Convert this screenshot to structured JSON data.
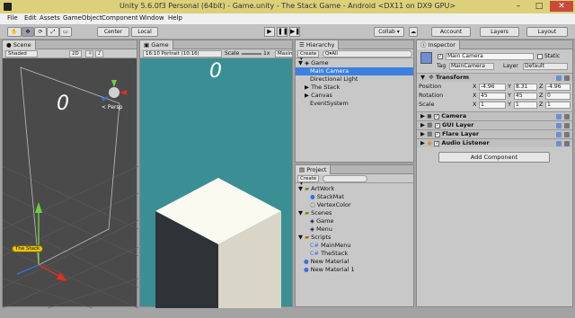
{
  "window": {
    "title": "Unity 5.6.0f3 Personal (64bit) - Game.unity - The Stack Game - Android <DX11 on DX9 GPU>",
    "minimize": "–",
    "maximize": "□",
    "close": "✕"
  },
  "menu": [
    "File",
    "Edit",
    "Assets",
    "GameObject",
    "Component",
    "Window",
    "Help"
  ],
  "toolbar": {
    "center_label": "Center",
    "local_label": "Local",
    "collab_label": "Collab ▾",
    "account_label": "Account",
    "layers_label": "Layers",
    "layout_label": "Layout"
  },
  "scene": {
    "tab_label": "Scene",
    "shading": "Shaded",
    "mode_2d": "2D",
    "score": "0",
    "persp_label": "< Persp",
    "camera_name": "The Stack"
  },
  "game": {
    "tab_label": "Game",
    "aspect": "16:10 Portrait (10:16)",
    "scale_label": "Scale",
    "scale_value": "1x",
    "maximize_label": "Maxim",
    "score": "0"
  },
  "hierarchy": {
    "tab_label": "Hierarchy",
    "create_label": "Create ▾",
    "search_placeholder": "Q▾All",
    "items": [
      {
        "label": "Game",
        "level": 0
      },
      {
        "label": "Main Camera",
        "level": 1
      },
      {
        "label": "Directional Light",
        "level": 1
      },
      {
        "label": "The Stack",
        "level": 1
      },
      {
        "label": "Canvas",
        "level": 1
      },
      {
        "label": "EventSystem",
        "level": 1
      }
    ]
  },
  "project": {
    "tab_label": "Project",
    "create_label": "Create ▾",
    "items": [
      {
        "label": "ArtWork",
        "level": 0
      },
      {
        "label": "StackMat",
        "level": 1
      },
      {
        "label": "VertexColor",
        "level": 1
      },
      {
        "label": "Scenes",
        "level": 0
      },
      {
        "label": "Game",
        "level": 1
      },
      {
        "label": "Menu",
        "level": 1
      },
      {
        "label": "Scripts",
        "level": 0
      },
      {
        "label": "MainMenu",
        "level": 1
      },
      {
        "label": "TheStack",
        "level": 1
      },
      {
        "label": "New Material",
        "level": 0
      },
      {
        "label": "New Material 1",
        "level": 0
      }
    ]
  },
  "inspector": {
    "tab_label": "Inspector",
    "object_name": "Main Camera",
    "static_label": "Static",
    "tag_label": "Tag",
    "tag_value": "MainCamera",
    "layer_label": "Layer",
    "layer_value": "Default",
    "transform_label": "Transform",
    "position_label": "Position",
    "rotation_label": "Rotation",
    "scale_label": "Scale",
    "axis_x": "X",
    "axis_y": "Y",
    "axis_z": "Z",
    "position": {
      "x": "-4.96",
      "y": "8.31",
      "z": "-4.96"
    },
    "rotation": {
      "x": "45",
      "y": "45",
      "z": "0"
    },
    "scale": {
      "x": "1",
      "y": "1",
      "z": "1"
    },
    "components": [
      "Camera",
      "GUI Layer",
      "Flare Layer",
      "Audio Listener"
    ],
    "add_component_label": "Add Component"
  },
  "colors": {
    "titlebar": "#ddd07a",
    "game_bg": "#3a8f94",
    "scene_bg": "#4a4a4a",
    "selection": "#3d80df",
    "cube_top": "#fafaf0",
    "cube_left": "#2e3338",
    "cube_right": "#d9d6c8"
  }
}
